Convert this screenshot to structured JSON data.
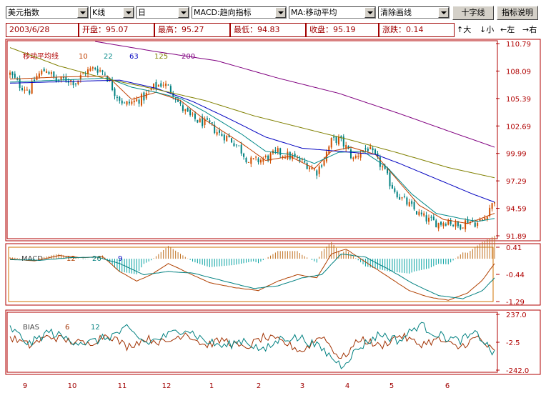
{
  "toolbar": {
    "symbol": "美元指数",
    "chart_type": "K线",
    "period": "日",
    "indicator": "MACD:趋向指标",
    "overlay": "MA:移动平均",
    "draw": "清除画线",
    "crosshair_label": "十字线",
    "help_label": "指标说明"
  },
  "info": {
    "date": "2003/6/28",
    "open": "开盘：95.07",
    "high": "最高：95.27",
    "low": "最低：94.83",
    "close": "收盘：95.19",
    "change": "涨跌：0.14"
  },
  "nav": {
    "zoom_in": "↑大",
    "zoom_out": "↓小",
    "left": "←左",
    "right": "→右"
  },
  "colors": {
    "frame": "#b00000",
    "up": "#d25000",
    "down": "#008080",
    "ma10": "#c04000",
    "ma22": "#008888",
    "ma63": "#0000c0",
    "ma125": "#808000",
    "ma200": "#800080",
    "macd_diff": "#b04000",
    "macd_dea": "#008080",
    "bias6": "#a03000",
    "bias12": "#008080"
  },
  "chart_data": [
    {
      "type": "candlestick",
      "legend": {
        "title": "移动平均线",
        "entries": [
          "10",
          "22",
          "63",
          "125",
          "200"
        ]
      },
      "y_ticks": [
        "110.79",
        "108.09",
        "105.39",
        "102.69",
        "99.99",
        "97.29",
        "94.59",
        "91.89"
      ],
      "ylim": [
        91.89,
        110.79
      ],
      "x_ticks": [
        "9",
        "10",
        "11",
        "12",
        "1",
        "2",
        "3",
        "4",
        "5",
        "6"
      ],
      "last_candle": {
        "date": "2003/6/28",
        "open": 95.07,
        "high": 95.27,
        "low": 94.83,
        "close": 95.19
      },
      "close_path": [
        [
          0,
          107.8
        ],
        [
          4,
          106.7
        ],
        [
          8,
          106.2
        ],
        [
          11,
          107.6
        ],
        [
          15,
          108.3
        ],
        [
          19,
          107.1
        ],
        [
          23,
          107.3
        ],
        [
          27,
          107.0
        ],
        [
          31,
          108.0
        ],
        [
          35,
          108.4
        ],
        [
          39,
          107.9
        ],
        [
          43,
          106.0
        ],
        [
          47,
          104.8
        ],
        [
          51,
          105.1
        ],
        [
          55,
          105.5
        ],
        [
          59,
          106.5
        ],
        [
          63,
          106.9
        ],
        [
          67,
          106.0
        ],
        [
          70,
          104.6
        ],
        [
          74,
          103.6
        ],
        [
          78,
          103.1
        ],
        [
          82,
          102.8
        ],
        [
          86,
          101.9
        ],
        [
          90,
          101.5
        ],
        [
          94,
          100.6
        ],
        [
          98,
          99.2
        ],
        [
          102,
          99.3
        ],
        [
          106,
          99.6
        ],
        [
          110,
          100.1
        ],
        [
          114,
          99.8
        ],
        [
          118,
          99.4
        ],
        [
          122,
          98.9
        ],
        [
          126,
          98.2
        ],
        [
          129,
          99.5
        ],
        [
          132,
          101.2
        ],
        [
          135,
          101.4
        ],
        [
          138,
          100.6
        ],
        [
          141,
          99.4
        ],
        [
          144,
          100.2
        ],
        [
          147,
          100.5
        ],
        [
          150,
          99.6
        ],
        [
          153,
          98.6
        ],
        [
          156,
          97.1
        ],
        [
          160,
          95.7
        ],
        [
          164,
          94.9
        ],
        [
          168,
          94.0
        ],
        [
          172,
          93.4
        ],
        [
          176,
          93.1
        ],
        [
          180,
          93.4
        ],
        [
          184,
          92.8
        ],
        [
          188,
          93.4
        ],
        [
          192,
          93.1
        ],
        [
          195,
          93.7
        ],
        [
          197,
          94.7
        ],
        [
          199,
          95.19
        ]
      ],
      "ma_path": {
        "ma10": [
          [
            0,
            107.3
          ],
          [
            20,
            107.5
          ],
          [
            40,
            107.6
          ],
          [
            50,
            105.3
          ],
          [
            60,
            106.0
          ],
          [
            70,
            105.2
          ],
          [
            80,
            103.3
          ],
          [
            95,
            101.0
          ],
          [
            105,
            99.3
          ],
          [
            115,
            99.7
          ],
          [
            125,
            98.5
          ],
          [
            132,
            100.2
          ],
          [
            140,
            100.6
          ],
          [
            150,
            99.9
          ],
          [
            158,
            97.7
          ],
          [
            168,
            94.9
          ],
          [
            178,
            93.5
          ],
          [
            188,
            93.1
          ],
          [
            199,
            94.1
          ]
        ],
        "ma22": [
          [
            0,
            107.0
          ],
          [
            20,
            107.2
          ],
          [
            40,
            107.4
          ],
          [
            50,
            106.5
          ],
          [
            60,
            106.0
          ],
          [
            70,
            105.4
          ],
          [
            80,
            104.1
          ],
          [
            95,
            101.9
          ],
          [
            105,
            100.2
          ],
          [
            115,
            99.9
          ],
          [
            125,
            99.0
          ],
          [
            135,
            100.1
          ],
          [
            145,
            100.2
          ],
          [
            155,
            98.6
          ],
          [
            165,
            96.0
          ],
          [
            175,
            94.1
          ],
          [
            185,
            93.6
          ],
          [
            192,
            93.3
          ],
          [
            199,
            93.6
          ]
        ],
        "ma63": [
          [
            0,
            106.9
          ],
          [
            30,
            107.1
          ],
          [
            45,
            107.2
          ],
          [
            60,
            106.4
          ],
          [
            75,
            105.1
          ],
          [
            90,
            103.4
          ],
          [
            105,
            101.6
          ],
          [
            120,
            100.5
          ],
          [
            135,
            100.2
          ],
          [
            150,
            99.9
          ],
          [
            160,
            99.0
          ],
          [
            175,
            97.5
          ],
          [
            190,
            96.0
          ],
          [
            199,
            95.2
          ]
        ],
        "ma125": [
          [
            0,
            110.4
          ],
          [
            20,
            108.6
          ],
          [
            40,
            107.3
          ],
          [
            60,
            106.3
          ],
          [
            80,
            105.2
          ],
          [
            100,
            103.7
          ],
          [
            120,
            102.5
          ],
          [
            140,
            101.3
          ],
          [
            160,
            100.0
          ],
          [
            180,
            98.6
          ],
          [
            199,
            97.6
          ]
        ],
        "ma200": [
          [
            0,
            112.6
          ],
          [
            30,
            111.2
          ],
          [
            60,
            110.0
          ],
          [
            85,
            109.1
          ],
          [
            110,
            107.4
          ],
          [
            135,
            105.9
          ],
          [
            160,
            103.9
          ],
          [
            180,
            102.2
          ],
          [
            199,
            100.6
          ]
        ]
      }
    },
    {
      "type": "line+bar",
      "legend": {
        "title": "MACD",
        "entries": [
          "12",
          "26",
          "9"
        ]
      },
      "y_ticks": [
        "0.41",
        "-0.44",
        "-1.29"
      ],
      "ylim": [
        -1.29,
        0.41
      ],
      "diff_path": [
        [
          0,
          0.05
        ],
        [
          10,
          -0.02
        ],
        [
          20,
          0.15
        ],
        [
          30,
          0.08
        ],
        [
          38,
          0.12
        ],
        [
          45,
          -0.35
        ],
        [
          52,
          -0.65
        ],
        [
          58,
          -0.45
        ],
        [
          65,
          -0.1
        ],
        [
          72,
          -0.35
        ],
        [
          82,
          -0.7
        ],
        [
          92,
          -0.85
        ],
        [
          102,
          -0.95
        ],
        [
          110,
          -0.65
        ],
        [
          118,
          -0.45
        ],
        [
          126,
          -0.55
        ],
        [
          132,
          0.2
        ],
        [
          138,
          0.35
        ],
        [
          146,
          -0.05
        ],
        [
          156,
          -0.55
        ],
        [
          164,
          -0.95
        ],
        [
          172,
          -1.15
        ],
        [
          180,
          -1.25
        ],
        [
          188,
          -1.02
        ],
        [
          194,
          -0.62
        ],
        [
          199,
          -0.1
        ]
      ],
      "dea_path": [
        [
          0,
          0.02
        ],
        [
          12,
          0.0
        ],
        [
          24,
          0.08
        ],
        [
          36,
          0.1
        ],
        [
          45,
          -0.1
        ],
        [
          55,
          -0.45
        ],
        [
          65,
          -0.35
        ],
        [
          75,
          -0.4
        ],
        [
          88,
          -0.65
        ],
        [
          100,
          -0.88
        ],
        [
          110,
          -0.8
        ],
        [
          120,
          -0.55
        ],
        [
          128,
          -0.45
        ],
        [
          136,
          0.2
        ],
        [
          146,
          0.1
        ],
        [
          156,
          -0.3
        ],
        [
          166,
          -0.75
        ],
        [
          176,
          -1.1
        ],
        [
          186,
          -1.2
        ],
        [
          194,
          -0.95
        ],
        [
          199,
          -0.55
        ]
      ]
    },
    {
      "type": "line",
      "legend": {
        "title": "BIAS",
        "entries": [
          "6",
          "12"
        ]
      },
      "y_ticks": [
        "237.0",
        "-2.5",
        "-242.0"
      ],
      "ylim": [
        -242.0,
        237.0
      ],
      "bias6_path": [
        [
          0,
          40
        ],
        [
          8,
          -30
        ],
        [
          16,
          50
        ],
        [
          24,
          10
        ],
        [
          32,
          -20
        ],
        [
          40,
          70
        ],
        [
          48,
          -40
        ],
        [
          56,
          30
        ],
        [
          64,
          -10
        ],
        [
          72,
          80
        ],
        [
          80,
          -30
        ],
        [
          88,
          20
        ],
        [
          96,
          -60
        ],
        [
          104,
          40
        ],
        [
          112,
          0
        ],
        [
          120,
          -80
        ],
        [
          128,
          60
        ],
        [
          136,
          -150
        ],
        [
          144,
          30
        ],
        [
          152,
          -40
        ],
        [
          160,
          60
        ],
        [
          168,
          -20
        ],
        [
          176,
          20
        ],
        [
          184,
          -50
        ],
        [
          192,
          40
        ],
        [
          199,
          -90
        ]
      ],
      "bias12_path": [
        [
          0,
          120
        ],
        [
          8,
          -20
        ],
        [
          16,
          90
        ],
        [
          24,
          20
        ],
        [
          32,
          -10
        ],
        [
          40,
          40
        ],
        [
          48,
          110
        ],
        [
          56,
          -10
        ],
        [
          64,
          50
        ],
        [
          72,
          120
        ],
        [
          80,
          10
        ],
        [
          88,
          -40
        ],
        [
          96,
          20
        ],
        [
          104,
          -80
        ],
        [
          112,
          40
        ],
        [
          120,
          30
        ],
        [
          128,
          -60
        ],
        [
          136,
          -200
        ],
        [
          144,
          -40
        ],
        [
          152,
          70
        ],
        [
          160,
          10
        ],
        [
          168,
          150
        ],
        [
          176,
          60
        ],
        [
          184,
          10
        ],
        [
          192,
          70
        ],
        [
          199,
          -110
        ]
      ]
    }
  ]
}
